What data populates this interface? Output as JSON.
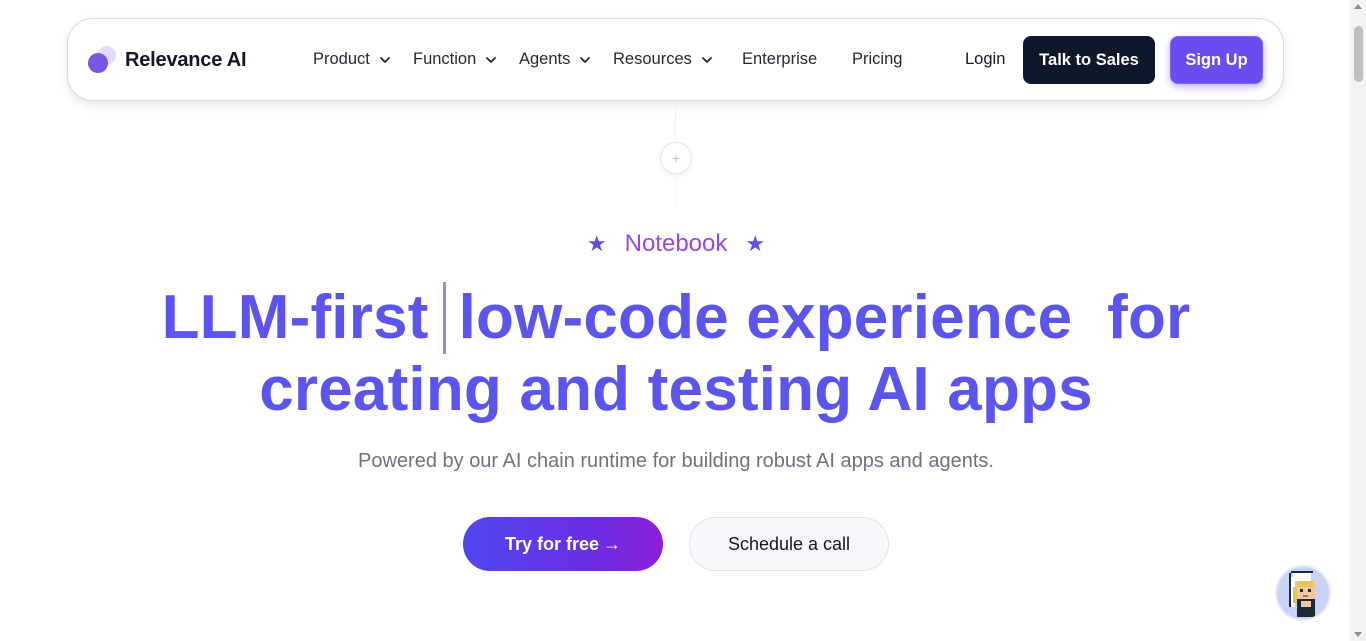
{
  "brand": {
    "name": "Relevance AI",
    "accent": "#5b55ee",
    "logo_primary": "#7b54e8",
    "logo_secondary": "#e2dbff"
  },
  "nav": {
    "menu": [
      {
        "label": "Product",
        "dropdown": true
      },
      {
        "label": "Function",
        "dropdown": true
      },
      {
        "label": "Agents",
        "dropdown": true
      },
      {
        "label": "Resources",
        "dropdown": true
      },
      {
        "label": "Enterprise",
        "dropdown": false
      },
      {
        "label": "Pricing",
        "dropdown": false
      }
    ],
    "login_label": "Login",
    "sales_label": "Talk to Sales",
    "signup_label": "Sign Up"
  },
  "hero": {
    "eyebrow": "Notebook",
    "star_icon": "★",
    "headline_part1": "LLM-first",
    "headline_part2": "low-code experience  for",
    "headline_line2": "creating and testing AI apps",
    "subtitle": "Powered by our AI chain runtime for building robust AI apps and agents.",
    "cta_primary": "Try for free",
    "cta_primary_icon": "→",
    "cta_secondary": "Schedule a call",
    "plus_glyph": "+"
  },
  "icons": {
    "chevron": "chevron-down-icon",
    "plus": "plus-icon",
    "star": "star-icon",
    "arrow": "arrow-right-icon",
    "chat": "chat-avatar-icon"
  }
}
